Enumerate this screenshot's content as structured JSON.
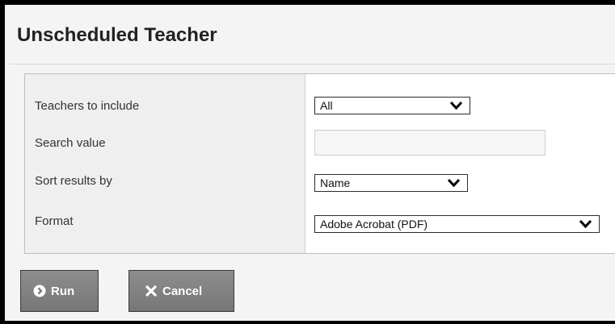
{
  "page": {
    "title": "Unscheduled Teacher"
  },
  "form": {
    "teachers_label": "Teachers to include",
    "teachers_value": "All",
    "search_label": "Search value",
    "search_value": "",
    "sort_label": "Sort results by",
    "sort_value": "Name",
    "format_label": "Format",
    "format_value": "Adobe Acrobat (PDF)"
  },
  "buttons": {
    "run_label": "Run",
    "run_icon": "chevron-circle-right-icon",
    "cancel_label": "Cancel",
    "cancel_icon": "x-icon"
  },
  "colors": {
    "button_bg": "#7f7f7f",
    "label_column_bg": "#efefef",
    "page_bg": "#f4f4f4"
  }
}
